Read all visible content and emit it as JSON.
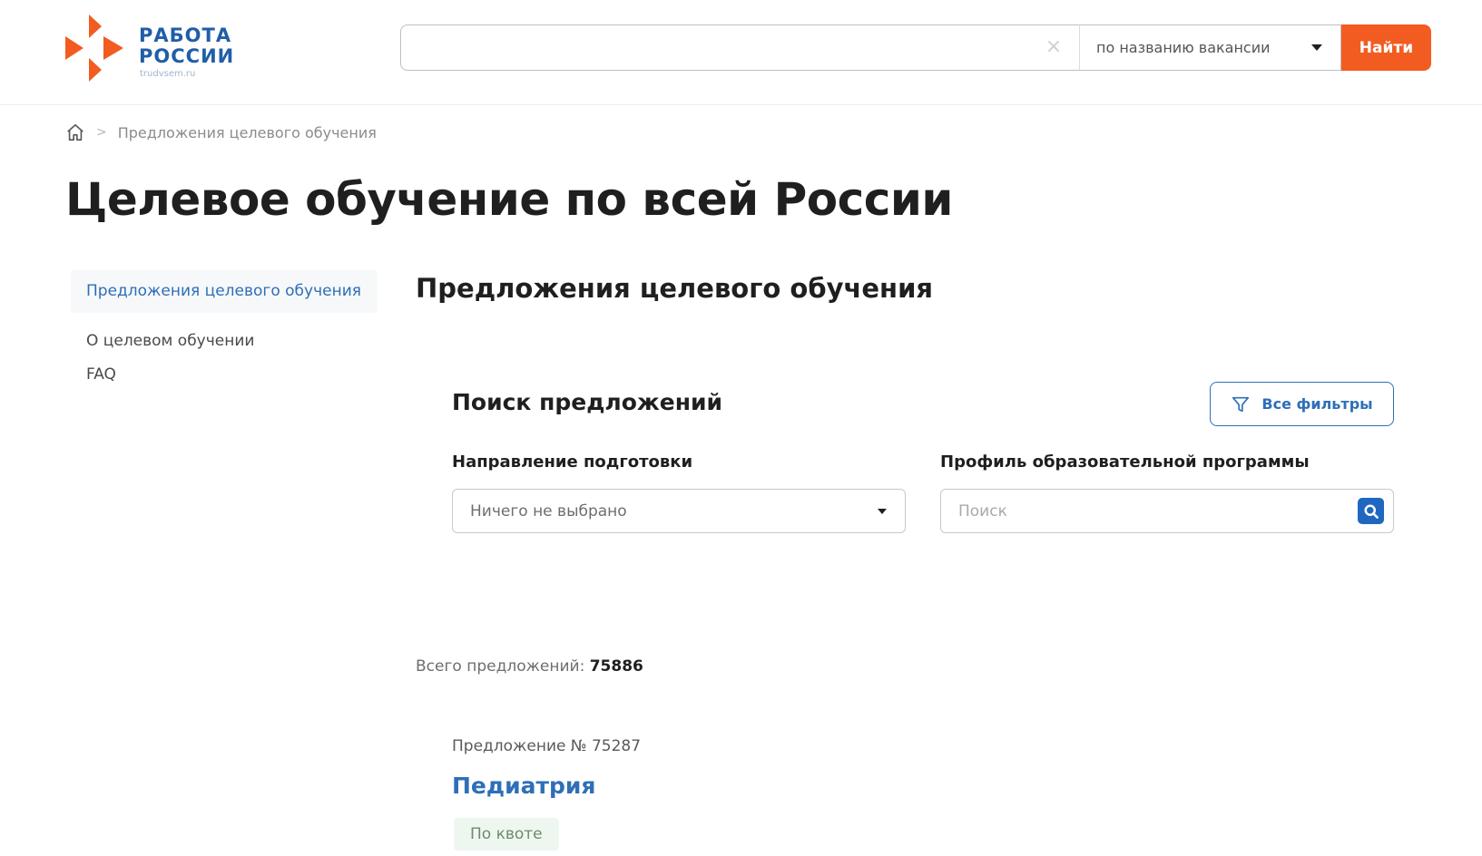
{
  "header": {
    "logo_title_line1": "РАБОТА",
    "logo_title_line2": "РОССИИ",
    "logo_sub": "trudvsem.ru",
    "search": {
      "value": "",
      "placeholder": "",
      "mode": "по названию вакансии",
      "button_label": "Найти"
    }
  },
  "breadcrumb": {
    "separator": ">",
    "current": "Предложения целевого обучения"
  },
  "page_title": "Целевое обучение по всей России",
  "sidebar": {
    "items": [
      {
        "label": "Предложения целевого обучения",
        "active": true
      },
      {
        "label": "О целевом обучении",
        "active": false
      },
      {
        "label": "FAQ",
        "active": false
      }
    ]
  },
  "main": {
    "section_title": "Предложения целевого обучения",
    "search_title": "Поиск предложений",
    "filters_button": "Все фильтры",
    "direction": {
      "label": "Направление подготовки",
      "value": "Ничего не выбрано"
    },
    "profile": {
      "label": "Профиль образовательной программы",
      "placeholder": "Поиск",
      "value": ""
    },
    "total_label": "Всего предложений:",
    "total_value": "75886",
    "offer": {
      "number": "Предложение № 75287",
      "title": "Педиатрия",
      "badge": "По квоте"
    }
  },
  "colors": {
    "accent_orange": "#f25c21",
    "brand_blue": "#1f5ea8",
    "link_blue": "#2e6fb7",
    "badge_bg": "#eef7ef"
  },
  "icons": [
    "logo-arrows-icon",
    "close-icon",
    "chevron-down-icon",
    "home-icon",
    "filter-icon",
    "search-icon"
  ]
}
